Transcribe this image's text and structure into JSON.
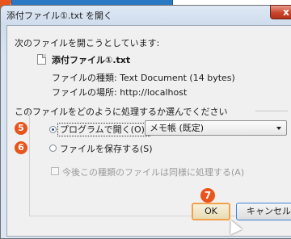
{
  "banner": {},
  "window": {
    "title": "添付ファイル①.txt を開く",
    "close_glyph": "x"
  },
  "dialog": {
    "intro": "次のファイルを開こうとしています:",
    "filename": "添付ファイル①.txt",
    "type_line": "ファイルの種類: Text Document (14 bytes)",
    "location_line": "ファイルの場所: http://localhost",
    "question": "このファイルをどのように処理するか選んでください",
    "open_with_label": "プログラムで開く(O):",
    "open_with_app": "メモ帳 (既定)",
    "save_file_label": "ファイルを保存する(S)",
    "remember_label": "今後この種類のファイルは同様に処理する(A)",
    "selected_option": "open_with"
  },
  "buttons": {
    "ok": "OK",
    "cancel": "キャンセル"
  },
  "markers": {
    "step5": "5",
    "step6": "6",
    "step7": "7"
  },
  "colors": {
    "marker": "#e8541b",
    "banner": "#2a79c4",
    "ok_focus": "#f2a14a"
  }
}
